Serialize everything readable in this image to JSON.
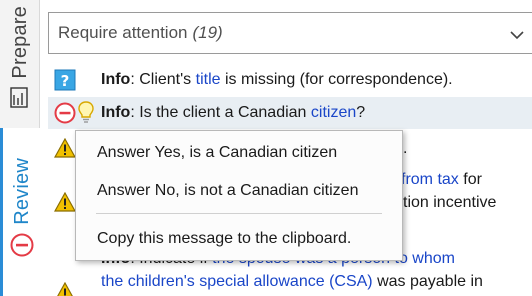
{
  "rail": {
    "prepare_label": "Prepare",
    "review_label": "Review"
  },
  "filter": {
    "label": "Require attention",
    "count": "(19)"
  },
  "messages": [
    {
      "icon": "question-icon",
      "type": "Info",
      "t1": ": Client's ",
      "link": "title",
      "t2": " is missing (for correspondence)."
    },
    {
      "icon": "error-icon",
      "type": "Info",
      "t1": ": Is the client a Canadian ",
      "link": "citizen",
      "t2": "?"
    }
  ],
  "context_menu": {
    "items": [
      "Answer Yes, is a Canadian citizen",
      "Answer No, is not a Canadian citizen",
      "Copy this message to the clipboard."
    ]
  },
  "partial": {
    "dot": ".",
    "from_tax": "from tax",
    "for_word": " for",
    "incentive": "tion incentive",
    "info_label": "Info",
    "indicate_tail": ": Indicate if ",
    "spouse_link": "the spouse was a person to whom",
    "csa_link": "the children's special allowance (CSA)",
    "payable": " was payable in"
  },
  "colors": {
    "accent": "#2a8cd6",
    "link": "#1a46c8",
    "warning": "#f0c000",
    "error": "#e43b46"
  }
}
